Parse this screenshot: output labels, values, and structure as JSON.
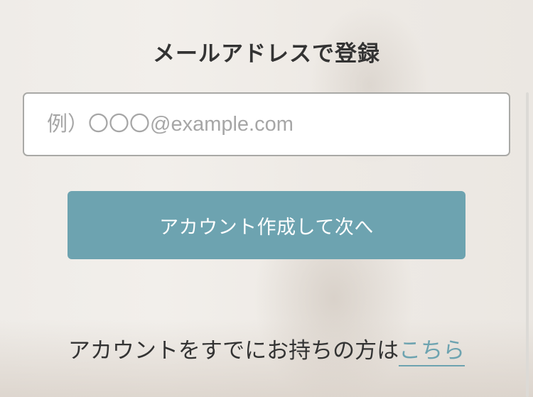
{
  "form": {
    "title": "メールアドレスで登録",
    "email_placeholder": "例）〇〇〇@example.com",
    "email_value": "",
    "submit_label": "アカウント作成して次へ"
  },
  "login_prompt": {
    "text": "アカウントをすでにお持ちの方は",
    "link_label": "こちら"
  },
  "colors": {
    "accent": "#6da3b0",
    "text": "#333333",
    "placeholder": "#a6a6a6",
    "field_border": "#a9a9a6"
  }
}
